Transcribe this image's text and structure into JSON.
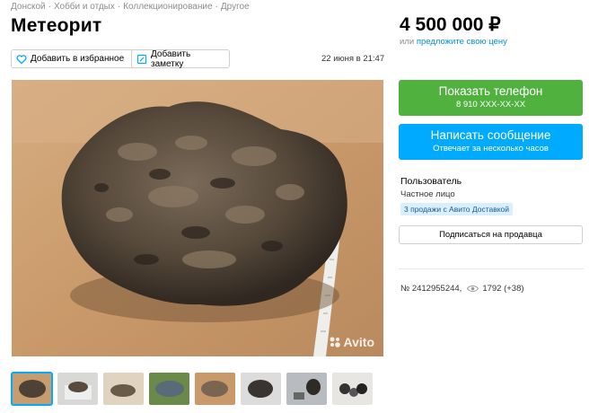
{
  "breadcrumb": [
    "Донской",
    "Хобби и отдых",
    "Коллекционирование",
    "Другое"
  ],
  "title": "Метеорит",
  "actions": {
    "favorite_label": "Добавить в избранное",
    "note_label": "Добавить заметку"
  },
  "date": "22 июня в 21:47",
  "photo": {
    "watermark": "Avito"
  },
  "thumbnails": [
    {
      "active": true
    },
    {
      "active": false
    },
    {
      "active": false
    },
    {
      "active": false
    },
    {
      "active": false
    },
    {
      "active": false
    },
    {
      "active": false
    },
    {
      "active": false
    }
  ],
  "price": {
    "value": "4 500 000 ₽",
    "or": "или",
    "offer_link": "предложите свою цену"
  },
  "buttons": {
    "phone_title": "Показать телефон",
    "phone_number": "8 910 XXX-XX-XX",
    "message_title": "Написать сообщение",
    "message_sub": "Отвечает за несколько часов",
    "subscribe": "Подписаться на продавца"
  },
  "seller": {
    "name": "Пользователь",
    "type": "Частное лицо",
    "delivery_badge": "3 продажи с Авито Доставкой"
  },
  "stats": {
    "ad_number": "№ 2412955244,",
    "views": "1792 (+38)"
  },
  "colors": {
    "phone_button": "#50b13e",
    "message_button": "#00aaff",
    "link": "#0091d9",
    "badge_bg": "#d9efff"
  }
}
